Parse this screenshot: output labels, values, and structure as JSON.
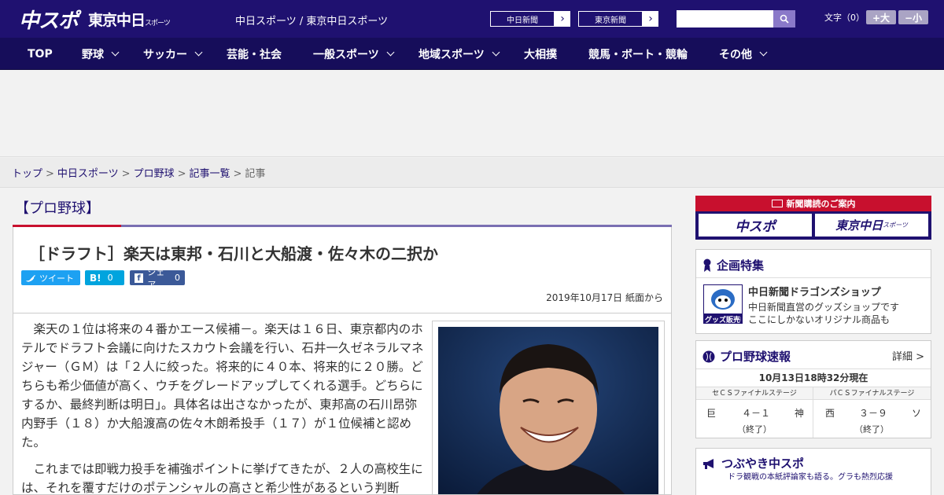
{
  "header": {
    "logo_main": "中スポ",
    "logo_tokyo": "東京中日",
    "logo_tokyo_small": "スポーツ",
    "site_names": "中日スポーツ / 東京中日スポーツ",
    "paper_buttons": [
      "中日新聞",
      "東京新聞"
    ],
    "search_placeholder": "",
    "font_label": "文字（0）",
    "font_bigger": "+大",
    "font_smaller": "−小"
  },
  "nav": {
    "items": [
      {
        "label": "TOP"
      },
      {
        "label": "野球"
      },
      {
        "label": "サッカー"
      },
      {
        "label": "芸能・社会"
      },
      {
        "label": "一般スポーツ"
      },
      {
        "label": "地域スポーツ"
      },
      {
        "label": "大相撲"
      },
      {
        "label": "競馬・ボート・競輪"
      },
      {
        "label": "その他"
      }
    ]
  },
  "breadcrumb": {
    "items": [
      "トップ",
      "中日スポーツ",
      "プロ野球",
      "記事一覧"
    ],
    "current": "記事",
    "separator": ">"
  },
  "article": {
    "category": "【プロ野球】",
    "title": "［ドラフト］楽天は東邦・石川と大船渡・佐々木の二択か",
    "tweet_label": "ツイート",
    "hatena_label": "B!",
    "hatena_count": "0",
    "share_label": "シェア",
    "share_count": "0",
    "date": "2019年10月17日 紙面から",
    "paragraphs": [
      "楽天の１位は将来の４番かエース候補－。楽天は１６日、東京都内のホテルでドラフト会議に向けたスカウト会議を行い、石井一久ゼネラルマネジャー（ＧＭ）は「２人に絞った。将来的に４０本、将来的に２０勝。どちらも希少価値が高く、ウチをグレードアップしてくれる選手。どちらにするか、最終判断は明日」。具体名は出さなかったが、東邦高の石川昂弥内野手（１８）か大船渡高の佐々木朗希投手（１７）が１位候補と認めた。",
      "これまでは即戦力投手を補強ポイントに挙げてきたが、２人の高校生には、それを覆すだけのポテンシャルの高さと希少性があるという判断"
    ]
  },
  "sidebar": {
    "subscription_title": "新聞購読のご案内",
    "sub_logo_1": "中スポ",
    "sub_logo_2": "東京中日",
    "sub_logo_2_small": "スポーツ",
    "feature_title": "企画特集",
    "shop_name": "中日新聞ドラゴンズショップ",
    "shop_desc_1": "中日新聞直営のグッズショップです",
    "shop_desc_2": "ここにしかないオリジナル商品も",
    "shop_badge": "グッズ販売中",
    "scores_title": "プロ野球速報",
    "scores_detail": "詳細 >",
    "scores_time": "10月13日18時32分現在",
    "games": [
      {
        "stage": "セＣＳファイナルステージ",
        "home": "巨",
        "score": "４－１",
        "away": "神",
        "status": "（終了）"
      },
      {
        "stage": "パＣＳファイナルステージ",
        "home": "西",
        "score": "３－９",
        "away": "ソ",
        "status": "（終了）"
      }
    ],
    "tsubuyaki_title": "つぶやき中スポ",
    "tsubuyaki_desc": "ドラ観戦の本紙評論家も語る。グラも熱烈応援"
  },
  "colors": {
    "brand_navy": "#1f1170",
    "nav_bg": "#160d5a",
    "accent_red": "#c8102e",
    "twitter": "#1da1f2",
    "hatena": "#00a4de",
    "facebook": "#3b5998"
  }
}
